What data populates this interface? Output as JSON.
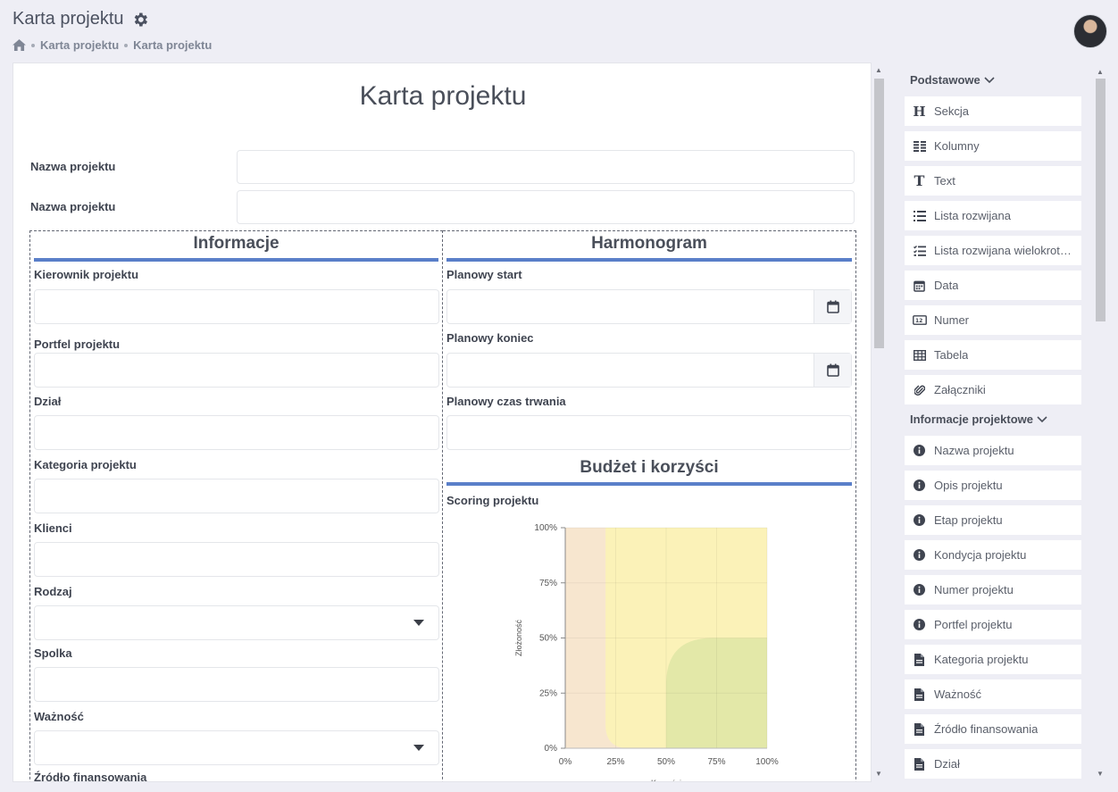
{
  "app": {
    "title": "Karta projektu"
  },
  "breadcrumb": [
    "Karta projektu",
    "Karta projektu"
  ],
  "form": {
    "title": "Karta projektu",
    "top_fields": [
      {
        "label": "Nazwa projektu",
        "value": ""
      },
      {
        "label": "Nazwa projektu",
        "value": ""
      }
    ],
    "sections": {
      "informacje": {
        "title": "Informacje",
        "fields": [
          {
            "label": "Kierownik projektu",
            "type": "text"
          },
          {
            "label": "Portfel projektu",
            "type": "text"
          },
          {
            "label": "Dział",
            "type": "text"
          },
          {
            "label": "Kategoria projektu",
            "type": "text"
          },
          {
            "label": "Klienci",
            "type": "text"
          },
          {
            "label": "Rodzaj",
            "type": "select"
          },
          {
            "label": "Spolka",
            "type": "text"
          },
          {
            "label": "Ważność",
            "type": "select"
          },
          {
            "label": "Źródło finansowania",
            "type": "text"
          }
        ]
      },
      "harmonogram": {
        "title": "Harmonogram",
        "fields": [
          {
            "label": "Planowy start",
            "type": "date"
          },
          {
            "label": "Planowy koniec",
            "type": "date"
          },
          {
            "label": "Planowy czas trwania",
            "type": "text"
          }
        ]
      },
      "budzet": {
        "title": "Budżet i korzyści",
        "scoring_label": "Scoring projektu"
      }
    }
  },
  "chart_data": {
    "type": "heatmap",
    "title": "",
    "xlabel": "Korzyści",
    "ylabel": "Złożoność",
    "xticks": [
      "0%",
      "25%",
      "50%",
      "75%",
      "100%"
    ],
    "yticks": [
      "0%",
      "25%",
      "50%",
      "75%",
      "100%"
    ],
    "xlim": [
      0,
      100
    ],
    "ylim": [
      0,
      100
    ],
    "zones": [
      {
        "name": "low",
        "color": "#f7e6cf",
        "x_from": 0,
        "x_to": 20
      },
      {
        "name": "medium",
        "color": "#fbf2b8",
        "x_from": 20,
        "x_to": 100
      },
      {
        "name": "high",
        "color": "#e3e8a8",
        "x_from": 50,
        "y_to": 50
      }
    ],
    "grid": true
  },
  "palette": {
    "groups": [
      {
        "title": "Podstawowe",
        "items": [
          {
            "label": "Sekcja",
            "icon": "heading-icon"
          },
          {
            "label": "Kolumny",
            "icon": "columns-icon"
          },
          {
            "label": "Text",
            "icon": "text-icon"
          },
          {
            "label": "Lista rozwijana",
            "icon": "list-icon"
          },
          {
            "label": "Lista rozwijana wielokrotnego wyboru",
            "icon": "checklist-icon"
          },
          {
            "label": "Data",
            "icon": "calendar-icon"
          },
          {
            "label": "Numer",
            "icon": "number-icon"
          },
          {
            "label": "Tabela",
            "icon": "table-icon"
          },
          {
            "label": "Załączniki",
            "icon": "paperclip-icon"
          }
        ]
      },
      {
        "title": "Informacje projektowe",
        "items": [
          {
            "label": "Nazwa projektu",
            "icon": "info-icon"
          },
          {
            "label": "Opis projektu",
            "icon": "info-icon"
          },
          {
            "label": "Etap projektu",
            "icon": "info-icon"
          },
          {
            "label": "Kondycja projektu",
            "icon": "info-icon"
          },
          {
            "label": "Numer projektu",
            "icon": "info-icon"
          },
          {
            "label": "Portfel projektu",
            "icon": "info-icon"
          },
          {
            "label": "Kategoria projektu",
            "icon": "file-icon"
          },
          {
            "label": "Ważność",
            "icon": "file-icon"
          },
          {
            "label": "Źródło finansowania",
            "icon": "file-icon"
          },
          {
            "label": "Dział",
            "icon": "file-icon"
          }
        ]
      }
    ]
  }
}
